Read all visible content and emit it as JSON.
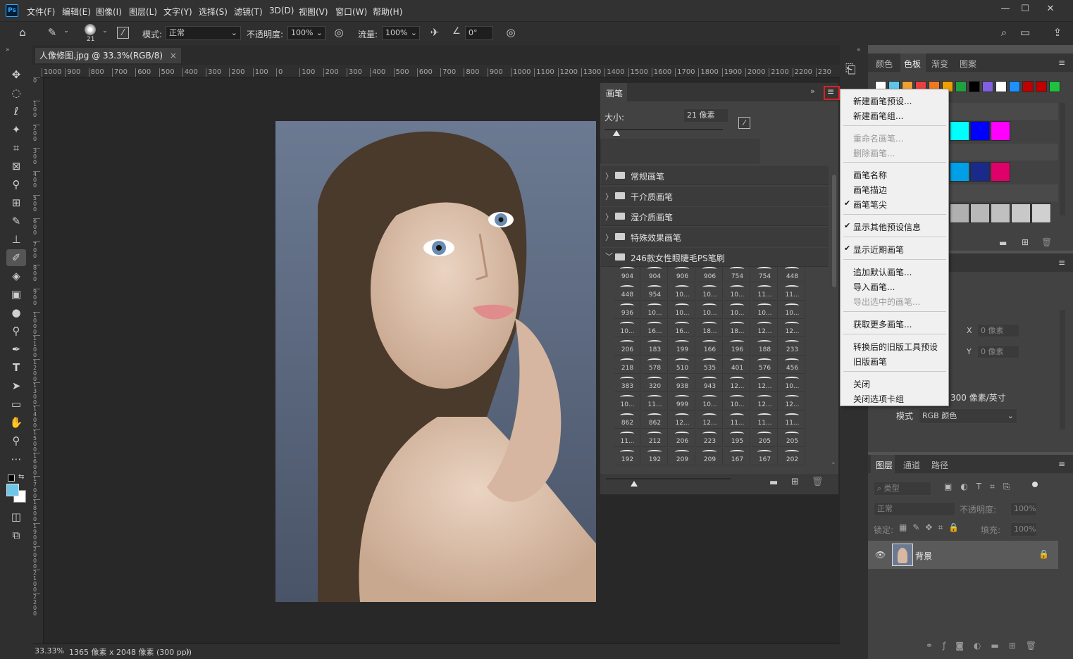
{
  "app": {
    "logo": "Ps"
  },
  "menu": [
    "文件(F)",
    "编辑(E)",
    "图像(I)",
    "图层(L)",
    "文字(Y)",
    "选择(S)",
    "滤镜(T)",
    "3D(D)",
    "视图(V)",
    "窗口(W)",
    "帮助(H)"
  ],
  "window_controls": {
    "minimize": "—",
    "maximize": "☐",
    "close": "✕"
  },
  "options": {
    "brush_size": "21",
    "mode_label": "模式:",
    "mode_value": "正常",
    "opacity_label": "不透明度:",
    "opacity_value": "100%",
    "flow_label": "流量:",
    "flow_value": "100%",
    "angle_value": "0°"
  },
  "document": {
    "tab_title": "人像修图.jpg @ 33.3%(RGB/8)",
    "tab_close": "×",
    "zoom": "33.33%",
    "info": "1365 像素 x 2048 像素 (300 ppi)",
    "info_arrow": "〉"
  },
  "ruler": {
    "h_ticks": [
      "1000",
      "900",
      "800",
      "700",
      "600",
      "500",
      "400",
      "300",
      "200",
      "100",
      "0",
      "100",
      "200",
      "300",
      "400",
      "500",
      "600",
      "700",
      "800",
      "900",
      "1000",
      "1100",
      "1200",
      "1300",
      "1400",
      "1500",
      "1600",
      "1700",
      "1800",
      "1900",
      "2000",
      "2100",
      "2200",
      "230"
    ],
    "v_ticks": [
      "0",
      "100",
      "200",
      "300",
      "400",
      "500",
      "600",
      "700",
      "800",
      "900",
      "1000",
      "1100",
      "1200",
      "1300",
      "1400",
      "1500",
      "1600",
      "1700",
      "1800",
      "1900",
      "2000",
      "2100",
      "2200"
    ]
  },
  "brush_panel": {
    "title": "画笔",
    "size_label": "大小:",
    "size_value": "21 像素",
    "groups": [
      "常规画笔",
      "干介质画笔",
      "湿介质画笔",
      "特殊效果画笔",
      "246款女性眼睫毛PS笔刷"
    ],
    "brush_numbers": [
      [
        "904",
        "904",
        "906",
        "906",
        "754",
        "754",
        "448"
      ],
      [
        "448",
        "954",
        "10...",
        "10...",
        "10...",
        "11...",
        "11..."
      ],
      [
        "936",
        "10...",
        "10...",
        "10...",
        "10...",
        "10...",
        "10..."
      ],
      [
        "10...",
        "16...",
        "16...",
        "18...",
        "18...",
        "12...",
        "12..."
      ],
      [
        "206",
        "183",
        "199",
        "166",
        "196",
        "188",
        "233"
      ],
      [
        "218",
        "578",
        "510",
        "535",
        "401",
        "576",
        "456"
      ],
      [
        "383",
        "320",
        "938",
        "943",
        "12...",
        "12...",
        "10..."
      ],
      [
        "10...",
        "11...",
        "999",
        "10...",
        "10...",
        "12...",
        "12..."
      ],
      [
        "862",
        "862",
        "12...",
        "12...",
        "11...",
        "11...",
        "11..."
      ],
      [
        "11...",
        "212",
        "206",
        "223",
        "195",
        "205",
        "205"
      ],
      [
        "192",
        "192",
        "209",
        "209",
        "167",
        "167",
        "202"
      ]
    ]
  },
  "context_menu": [
    {
      "label": "新建画笔预设...",
      "disabled": false,
      "checked": false
    },
    {
      "label": "新建画笔组...",
      "disabled": false,
      "checked": false
    },
    {
      "label": "重命名画笔...",
      "disabled": true,
      "checked": false
    },
    {
      "label": "删除画笔...",
      "disabled": true,
      "checked": false
    },
    {
      "label": "画笔名称",
      "disabled": false,
      "checked": false
    },
    {
      "label": "画笔描边",
      "disabled": false,
      "checked": false
    },
    {
      "label": "画笔笔尖",
      "disabled": false,
      "checked": true
    },
    {
      "label": "显示其他预设信息",
      "disabled": false,
      "checked": true
    },
    {
      "label": "显示近期画笔",
      "disabled": false,
      "checked": true
    },
    {
      "label": "追加默认画笔...",
      "disabled": false,
      "checked": false
    },
    {
      "label": "导入画笔...",
      "disabled": false,
      "checked": false
    },
    {
      "label": "导出选中的画笔...",
      "disabled": true,
      "checked": false
    },
    {
      "label": "获取更多画笔...",
      "disabled": false,
      "checked": false
    },
    {
      "label": "转换后的旧版工具预设",
      "disabled": false,
      "checked": false
    },
    {
      "label": "旧版画笔",
      "disabled": false,
      "checked": false
    },
    {
      "label": "关闭",
      "disabled": false,
      "checked": false
    },
    {
      "label": "关闭选项卡组",
      "disabled": false,
      "checked": false
    }
  ],
  "swatch_panel": {
    "tabs": [
      "颜色",
      "色板",
      "渐变",
      "图案"
    ],
    "colors_row1": [
      "#ffffff",
      "#5bc8e8",
      "#f0a030",
      "#e84040",
      "#f07820",
      "#f0a000",
      "#20a040",
      "#000000",
      "#8060e0",
      "#ffffff",
      "#1e90ff",
      "#c00000",
      "#c00000",
      "#20c040"
    ],
    "colors_row2": [
      "#00ffff",
      "#0000ff",
      "#ff00ff"
    ],
    "colors_row3": [
      "#00a0e8",
      "#1a2a8a",
      "#e0006a"
    ],
    "colors_row4": [
      "#b0b0b0",
      "#b8b8b8",
      "#c0c0c0",
      "#c8c8c8",
      "#d0d0d0"
    ]
  },
  "properties_panel": {
    "x_label": "X",
    "x_value": "0 像素",
    "y_label": "Y",
    "y_value": "0 像素",
    "resolution": "300 像素/英寸",
    "mode_label": "模式",
    "mode_value": "RGB 颜色"
  },
  "layers_panel": {
    "tabs": [
      "图层",
      "通道",
      "路径"
    ],
    "filter_placeholder": "类型",
    "blend_mode": "正常",
    "opacity_label": "不透明度:",
    "opacity_value": "100%",
    "lock_label": "锁定:",
    "fill_label": "填充:",
    "fill_value": "100%",
    "layer_name": "背景"
  }
}
